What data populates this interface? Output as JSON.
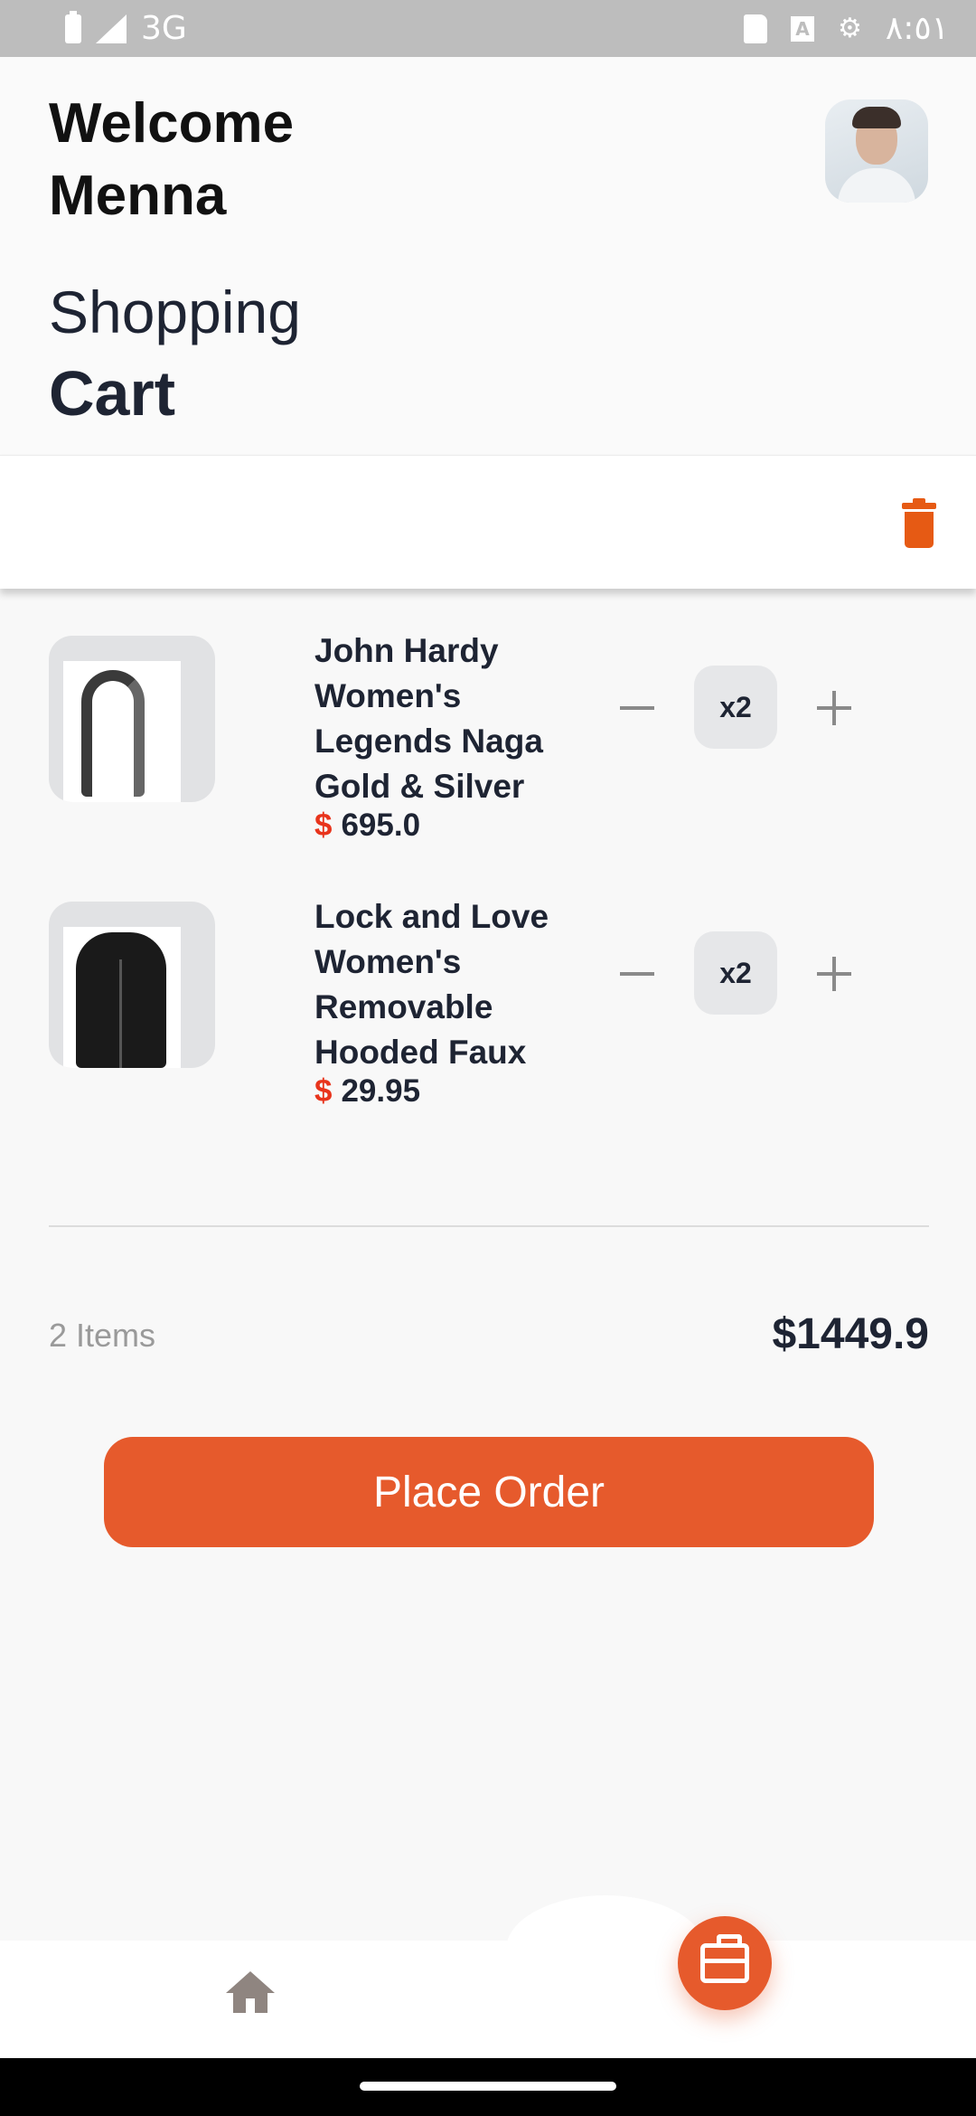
{
  "status_bar": {
    "network": "3G",
    "time": "٨:٥١",
    "icons": [
      "battery-icon",
      "signal-icon",
      "sd-card-icon",
      "keyboard-a-icon",
      "settings-icon"
    ]
  },
  "header": {
    "welcome_line1": "Welcome",
    "welcome_line2": "Menna",
    "title_line1": "Shopping",
    "title_line2": "Cart"
  },
  "cart": {
    "items": [
      {
        "name": "John Hardy Women's Legends Naga Gold & Silver Dragon Station Chain Bracelet",
        "currency": "$",
        "price": "695.0",
        "quantity": "x2",
        "image_icon": "bracelet-image"
      },
      {
        "name": "Lock and Love Women's Removable Hooded Faux Leather Moto Biker Jacket",
        "currency": "$",
        "price": "29.95",
        "quantity": "x2",
        "image_icon": "jacket-image"
      }
    ],
    "items_count": "2 Items",
    "total": "$1449.9"
  },
  "actions": {
    "place_order": "Place Order"
  },
  "colors": {
    "accent": "#e65a2c",
    "price_currency": "#e8341c",
    "text_dark": "#1e2433",
    "muted": "#9a9a9a"
  }
}
